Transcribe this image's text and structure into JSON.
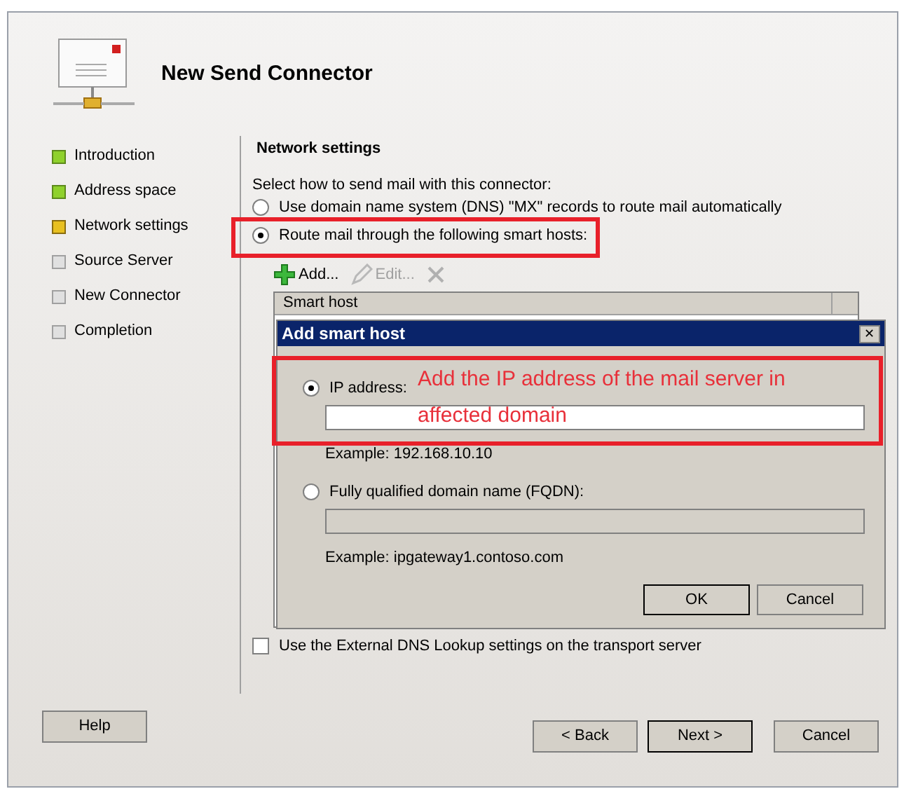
{
  "window": {
    "title": "New Send Connector"
  },
  "steps": [
    {
      "label": "Introduction",
      "kind": "complete"
    },
    {
      "label": "Address space",
      "kind": "complete"
    },
    {
      "label": "Network settings",
      "kind": "current"
    },
    {
      "label": "Source Server",
      "kind": "pending"
    },
    {
      "label": "New Connector",
      "kind": "pending"
    },
    {
      "label": "Completion",
      "kind": "pending"
    }
  ],
  "section_title": "Network settings",
  "instruction": "Select how to send mail with this connector:",
  "routing_options": [
    {
      "label": "Use domain name system (DNS) \"MX\" records to route mail automatically",
      "selected": false
    },
    {
      "label": "Route mail through the following smart hosts:",
      "selected": true
    }
  ],
  "toolbar": [
    {
      "kind": "add",
      "label": "Add...",
      "disabled": false
    },
    {
      "kind": "edit",
      "label": "Edit...",
      "disabled": true
    },
    {
      "kind": "remove",
      "disabled": true
    }
  ],
  "table": {
    "columns": [
      "Smart host"
    ]
  },
  "external_dns": {
    "label": "Use the External DNS Lookup settings on the transport server",
    "checked": false
  },
  "dialog": {
    "title": "Add smart host",
    "close": "✕",
    "options": [
      {
        "label": "IP address:",
        "selected": true,
        "example": "Example: 192.168.10.10"
      },
      {
        "label": "Fully qualified domain name (FQDN):",
        "selected": false,
        "example": "Example: ipgateway1.contoso.com"
      }
    ],
    "buttons": [
      "OK",
      "Cancel"
    ]
  },
  "buttons": {
    "help": "Help",
    "back": "< Back",
    "next": "Next >",
    "cancel": "Cancel"
  },
  "annotation": {
    "lines": [
      "Add the IP address of the mail server in",
      "affected domain"
    ]
  }
}
